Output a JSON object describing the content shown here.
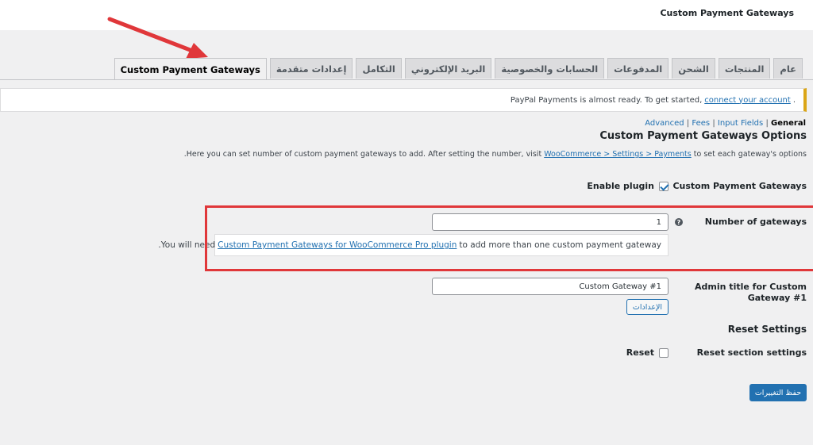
{
  "header": {
    "title": "Custom Payment Gateways"
  },
  "tabs": [
    {
      "label": "عام"
    },
    {
      "label": "المنتجات"
    },
    {
      "label": "الشحن"
    },
    {
      "label": "المدفوعات"
    },
    {
      "label": "الحسابات والخصوصية"
    },
    {
      "label": "البريد الإلكتروني"
    },
    {
      "label": "التكامل"
    },
    {
      "label": "إعدادات متقدمة"
    },
    {
      "label": "Custom Payment Gateways"
    }
  ],
  "notice": {
    "text": "PayPal Payments is almost ready. To get started,",
    "link": "connect your account",
    "trail": "."
  },
  "subnav": {
    "advanced": "Advanced",
    "fees": "Fees",
    "input_fields": "Input Fields",
    "general": "General",
    "sep": "|"
  },
  "section": {
    "title": "Custom Payment Gateways Options",
    "desc_before": "Here you can set number of custom payment gateways to add. After setting the number, visit",
    "desc_link": "WooCommerce > Settings > Payments",
    "desc_after": "to set each gateway's options",
    "desc_dot": "."
  },
  "form": {
    "cpg_label": "Custom Payment Gateways",
    "enable_label": "Enable plugin",
    "enable_checked": true,
    "number_label": "Number of gateways",
    "number_value": "1",
    "help_icon": "question-circle-icon",
    "pro_before": "You will need",
    "pro_link": "Custom Payment Gateways for WooCommerce Pro plugin",
    "pro_after": "to add more than one custom payment gateway",
    "pro_dot": ".",
    "admin_title_label_1": "Admin title for Custom",
    "admin_title_label_2": "Gateway #1",
    "admin_title_value": "Custom Gateway #1",
    "settings_button": "الإعدادات",
    "reset_title": "Reset Settings",
    "reset_section_label": "Reset section settings",
    "reset_label": "Reset",
    "reset_checked": false,
    "save_button": "حفظ التغييرات"
  },
  "colors": {
    "accent": "#2271b1",
    "highlight": "#e0373a",
    "notice_border": "#dba617"
  }
}
